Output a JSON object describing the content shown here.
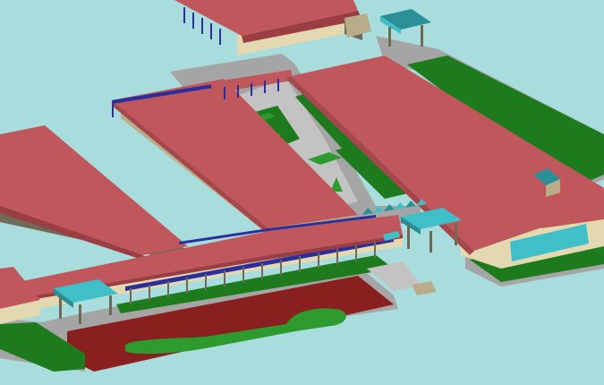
{
  "scene": {
    "type": "isometric-3d-architectural-model",
    "colors": {
      "background": "#a9dcdc",
      "roof": "#c0575c",
      "roof_shade": "#a5474c",
      "roof_edge": "#9a3e44",
      "wall": "#e3d8b0",
      "wall_shade": "#b8ad88",
      "wall_dark": "#6f6a55",
      "paving": "#a5a5a5",
      "paving_light": "#c3c3c3",
      "lawn": "#1d7a1d",
      "lawn_light": "#2d9a2d",
      "court": "#8a1f1f",
      "glass": "#3fbfc7",
      "glass_dark": "#2a8f96",
      "steel_blue": "#2b2f9e",
      "kerb": "#7a7a7a",
      "trim": "#ffd34d"
    }
  }
}
